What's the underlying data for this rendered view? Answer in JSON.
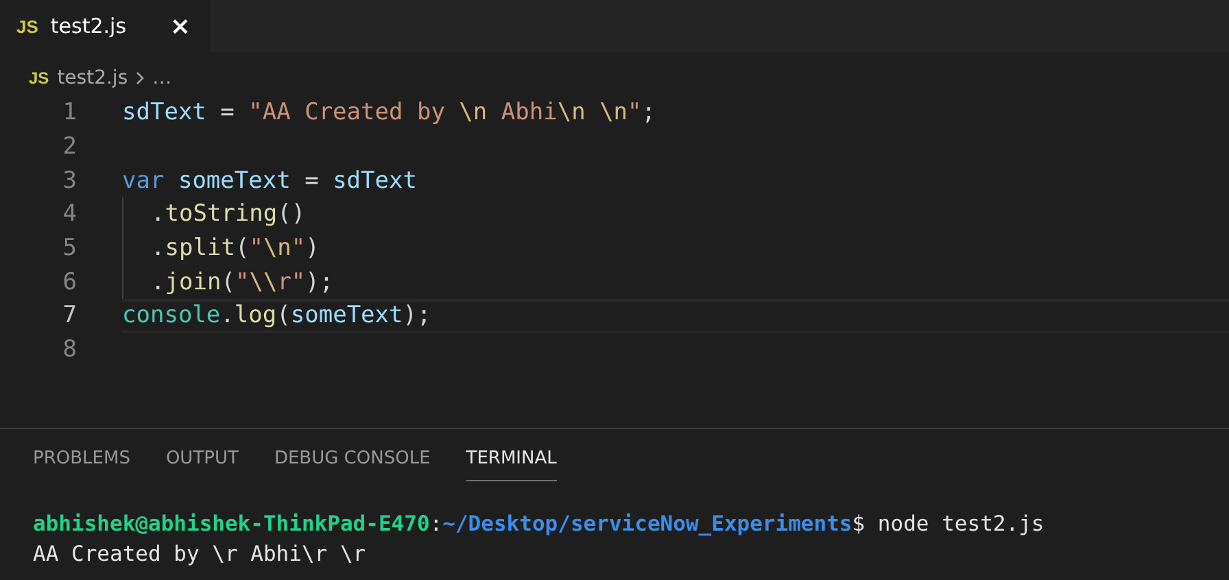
{
  "tabs": [
    {
      "icon": "JS",
      "label": "test2.js",
      "close": "×",
      "selected": true
    }
  ],
  "breadcrumbs": {
    "icon": "JS",
    "file": "test2.js",
    "more": "…"
  },
  "editor": {
    "lines": [
      {
        "number": "1",
        "current": false,
        "tokens": [
          {
            "kind": "variable",
            "text": "sdText"
          },
          {
            "kind": "plain",
            "text": " = "
          },
          {
            "kind": "string",
            "text": "\"AA Created by "
          },
          {
            "kind": "escape",
            "text": "\\n"
          },
          {
            "kind": "string",
            "text": " Abhi"
          },
          {
            "kind": "escape",
            "text": "\\n "
          },
          {
            "kind": "escape",
            "text": "\\n"
          },
          {
            "kind": "string",
            "text": "\""
          },
          {
            "kind": "plain",
            "text": ";"
          }
        ]
      },
      {
        "number": "2",
        "current": false
      },
      {
        "number": "3",
        "current": false,
        "tokens": [
          {
            "kind": "keyword",
            "text": "var "
          },
          {
            "kind": "variable",
            "text": "someText"
          },
          {
            "kind": "plain",
            "text": " = "
          },
          {
            "kind": "variable",
            "text": "sdText"
          }
        ]
      },
      {
        "number": "4",
        "current": false,
        "indent_guide": true,
        "tokens": [
          {
            "kind": "plain",
            "text": "."
          },
          {
            "kind": "function",
            "text": "toString"
          },
          {
            "kind": "plain",
            "text": "()"
          }
        ]
      },
      {
        "number": "5",
        "current": false,
        "indent_guide": true,
        "tokens": [
          {
            "kind": "plain",
            "text": "."
          },
          {
            "kind": "function",
            "text": "split"
          },
          {
            "kind": "plain",
            "text": "("
          },
          {
            "kind": "string",
            "text": "\""
          },
          {
            "kind": "escape",
            "text": "\\n"
          },
          {
            "kind": "string",
            "text": "\""
          },
          {
            "kind": "plain",
            "text": ")"
          }
        ]
      },
      {
        "number": "6",
        "current": false,
        "indent_guide": true,
        "tokens": [
          {
            "kind": "plain",
            "text": "."
          },
          {
            "kind": "function",
            "text": "join"
          },
          {
            "kind": "plain",
            "text": "("
          },
          {
            "kind": "string",
            "text": "\""
          },
          {
            "kind": "escape",
            "text": "\\\\"
          },
          {
            "kind": "string",
            "text": "r\""
          },
          {
            "kind": "plain",
            "text": ");"
          }
        ]
      },
      {
        "number": "7",
        "current": true,
        "tokens": [
          {
            "kind": "class",
            "text": "console"
          },
          {
            "kind": "plain",
            "text": "."
          },
          {
            "kind": "function",
            "text": "log"
          },
          {
            "kind": "plain",
            "text": "("
          },
          {
            "kind": "variable",
            "text": "someText"
          },
          {
            "kind": "plain",
            "text": ");"
          }
        ]
      },
      {
        "number": "8",
        "current": false
      }
    ]
  },
  "panel": {
    "tabs": [
      {
        "label": "PROBLEMS",
        "selected": false
      },
      {
        "label": "OUTPUT",
        "selected": false
      },
      {
        "label": "DEBUG CONSOLE",
        "selected": false
      },
      {
        "label": "TERMINAL",
        "selected": true
      }
    ],
    "terminal": [
      {
        "segments": [
          {
            "kind": "user",
            "text": "abhishek@abhishek-ThinkPad-E470"
          },
          {
            "kind": "plain",
            "text": ":"
          },
          {
            "kind": "path",
            "text": "~/Desktop/serviceNow_Experiments"
          },
          {
            "kind": "plain",
            "text": "$ node test2.js"
          }
        ]
      },
      {
        "segments": [
          {
            "kind": "plain",
            "text": "AA Created by \\r Abhi\\r \\r"
          }
        ]
      }
    ]
  }
}
